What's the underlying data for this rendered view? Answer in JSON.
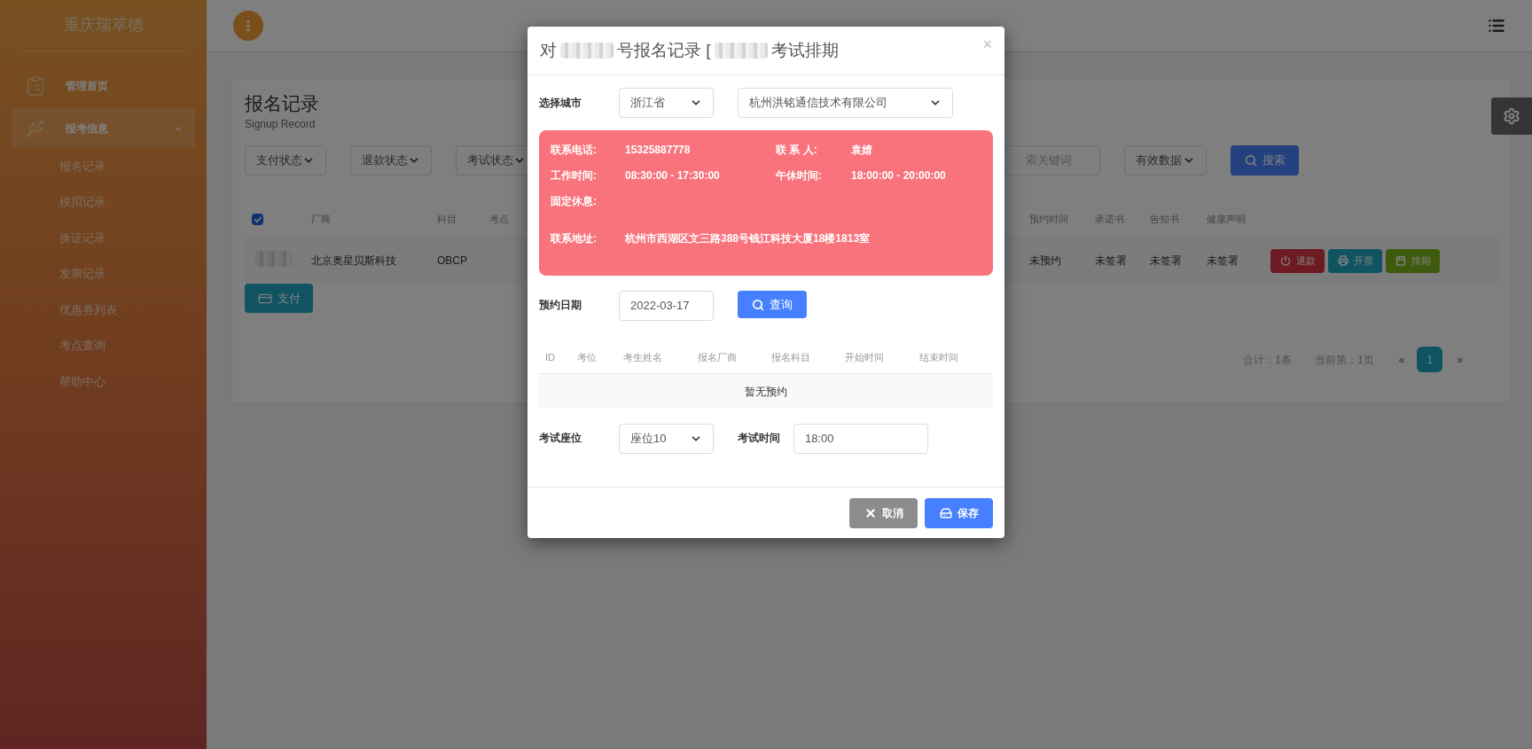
{
  "sidebar": {
    "brand": "重庆瑞萃德",
    "items": [
      {
        "label": "管理首页",
        "kind": "clipboard",
        "selected": false
      },
      {
        "label": "报考信息",
        "kind": "usb",
        "selected": true,
        "expanded": true,
        "children": [
          {
            "label": "报名记录"
          },
          {
            "label": "模拟记录"
          },
          {
            "label": "换证记录"
          },
          {
            "label": "发票记录"
          },
          {
            "label": "优惠券列表"
          },
          {
            "label": "考点查询"
          },
          {
            "label": "帮助中心"
          }
        ]
      }
    ]
  },
  "page": {
    "title": "报名记录",
    "subtitle": "Signup Record",
    "filters": [
      {
        "label": "支付状态"
      },
      {
        "label": "退款状态"
      },
      {
        "label": "考试状态"
      }
    ],
    "search": {
      "placeholder": "索关键词"
    },
    "validity": {
      "label": "有效数据"
    },
    "search_button": "搜索",
    "columns": [
      "厂商",
      "科目",
      "考点",
      "预约时间",
      "承诺书",
      "告知书",
      "健康声明"
    ],
    "select_all": {
      "checked": true
    },
    "rows": [
      {
        "vendor": "北京奥星贝斯科技",
        "subject": "OBCP",
        "booking": "未预约",
        "pledge": "未签署",
        "notice": "未签署",
        "health": "未签署"
      }
    ],
    "row_actions": [
      {
        "label": "退款",
        "kind": "refund"
      },
      {
        "label": "开票",
        "kind": "invoice"
      },
      {
        "label": "排期",
        "kind": "schedule"
      }
    ],
    "pay_button": "支付",
    "pagination": {
      "total": "合计：1条",
      "current": "当前第：1页",
      "prev": "«",
      "pages": [
        {
          "label": "1",
          "selected": true
        }
      ],
      "next": "»"
    }
  },
  "modal": {
    "title": {
      "prefix": "对",
      "middle": "号报名记录 [",
      "suffix": "考试排期"
    },
    "close": "×",
    "city_label": "选择城市",
    "province": "浙江省",
    "center": "杭州洪铭通信技术有限公司",
    "info": [
      {
        "label": "联系电话:",
        "value": "15325887778"
      },
      {
        "label": "联 系 人:",
        "value": "袁婧"
      },
      {
        "label": "工作时间:",
        "value": "08:30:00 - 17:30:00"
      },
      {
        "label": "午休时间:",
        "value": "18:00:00 - 20:00:00"
      },
      {
        "label": "固定休息:"
      }
    ],
    "address": {
      "label": "联系地址:",
      "value": "杭州市西湖区文三路388号钱江科技大厦18楼1813室"
    },
    "date_label": "预约日期",
    "date": "2022-03-17",
    "query_button": "查询",
    "columns": [
      "ID",
      "考位",
      "考生姓名",
      "报名厂商",
      "报名科目",
      "开始时间",
      "结束时间"
    ],
    "empty": "暂无预约",
    "seat_label": "考试座位",
    "seat": "座位10",
    "time_label": "考试时间",
    "time": "18:00",
    "cancel": "取消",
    "save": "保存"
  }
}
